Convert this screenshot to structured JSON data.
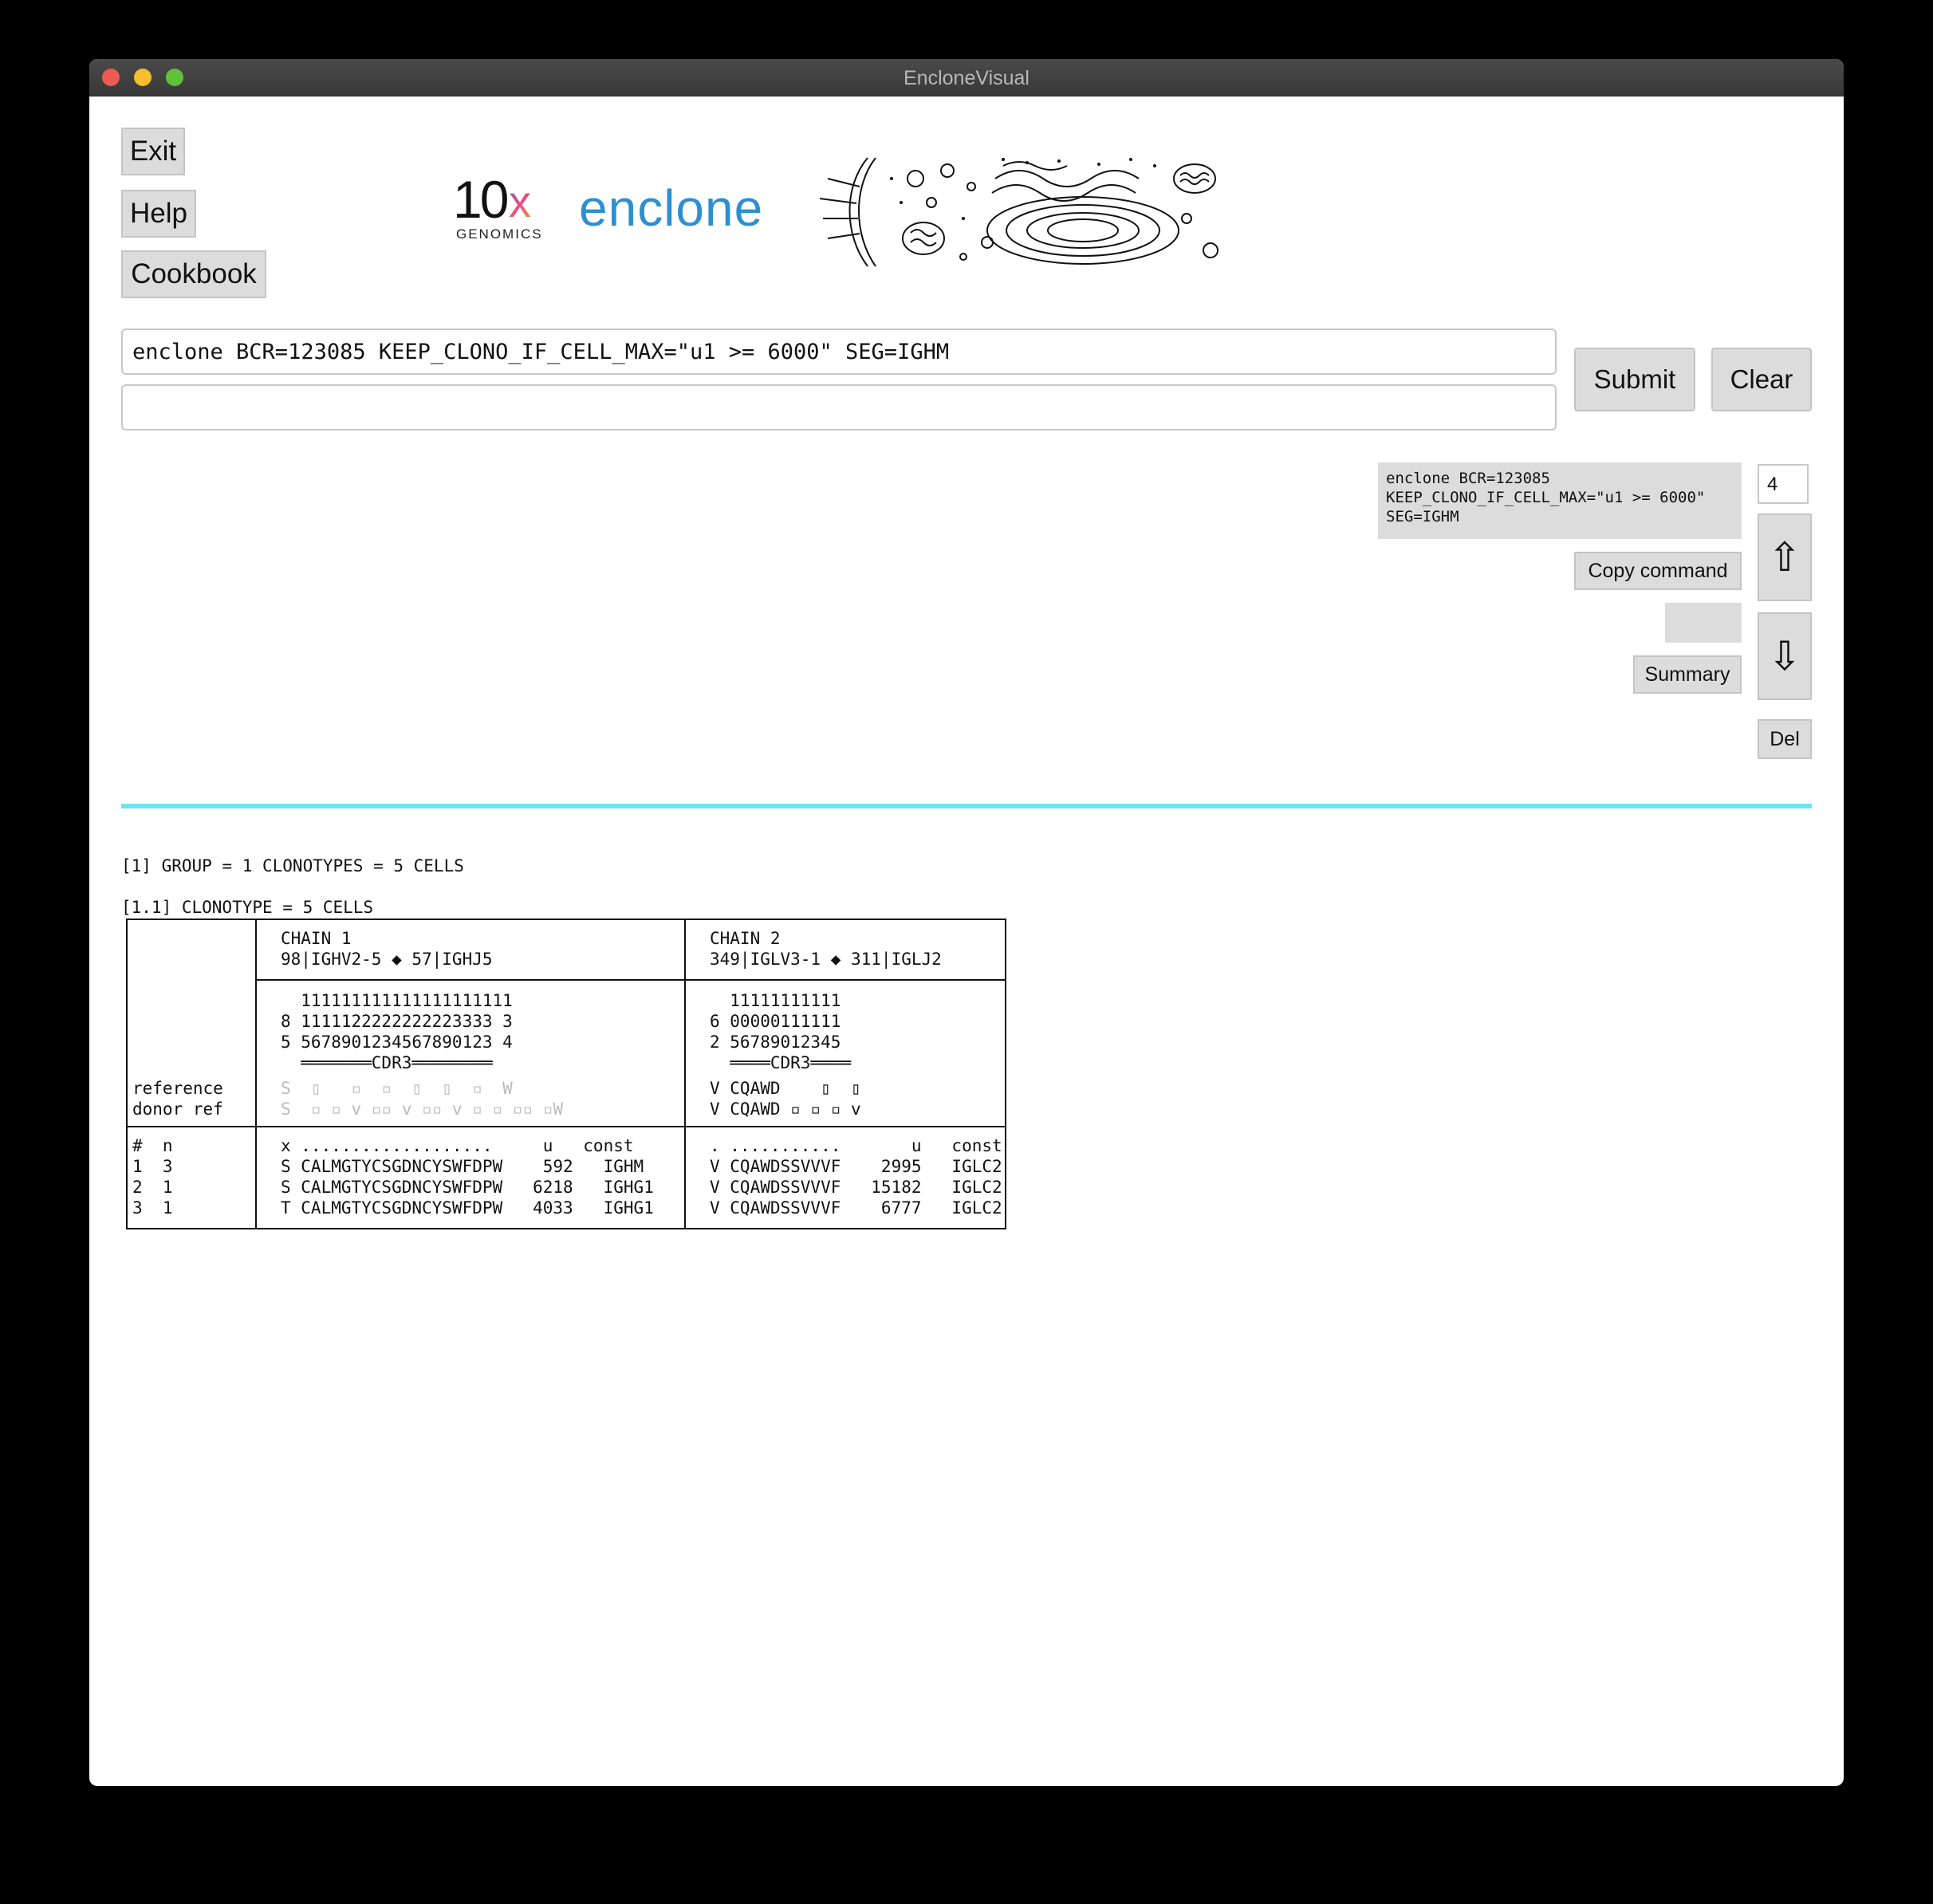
{
  "window": {
    "title": "EncloneVisual"
  },
  "left_buttons": {
    "exit": "Exit",
    "help": "Help",
    "cookbook": "Cookbook"
  },
  "logo": {
    "brand_number": "10",
    "brand_x": "x",
    "brand_sub": "GENOMICS",
    "product": "enclone"
  },
  "command": {
    "input_value": "enclone BCR=123085 KEEP_CLONO_IF_CELL_MAX=\"u1 >= 6000\" SEG=IGHM",
    "second_input_value": "",
    "submit": "Submit",
    "clear": "Clear"
  },
  "history": {
    "command_line1": "enclone BCR=123085",
    "command_line2": "KEEP_CLONO_IF_CELL_MAX=\"u1 >= 6000\"",
    "command_line3": "SEG=IGHM",
    "index": "4",
    "copy_command": "Copy command",
    "name_box": "",
    "summary": "Summary",
    "up_icon": "arrow-up-icon",
    "down_icon": "arrow-down-icon",
    "up_glyph": "⇧",
    "down_glyph": "⇩",
    "del": "Del"
  },
  "output": {
    "group_header": "[1] GROUP = 1 CLONOTYPES = 5 CELLS",
    "clonotype_header": "[1.1] CLONOTYPE = 5 CELLS",
    "table": {
      "left_labels_1": "reference",
      "left_labels_2": "donor ref",
      "rows_head": "#  n",
      "row1_left": "1  3",
      "row2_left": "2  1",
      "row3_left": "3  1",
      "chain1": {
        "title": "CHAIN 1",
        "subtitle": "98|IGHV2-5 ◆ 57|IGHJ5",
        "pos_line1": "  111111111111111111111",
        "pos_line2": "8 1111122222222223333 3",
        "pos_line3": "5 5678901234567890123 4",
        "cdr3_line": "  ═══════CDR3════════",
        "ref_line": "S  ▯   ▫  ▫  ▯  ▯  ▫  W",
        "donor_line": "S  ▫ ▫ v ▫▫ v ▫▫ v ▫ ▫ ▫▫ ▫W",
        "head_line": "x ...................     u   const",
        "row1": "S CALMGTYCSGDNCYSWFDPW    592   IGHM",
        "row2": "S CALMGTYCSGDNCYSWFDPW   6218   IGHG1",
        "row3": "T CALMGTYCSGDNCYSWFDPW   4033   IGHG1"
      },
      "chain2": {
        "title": "CHAIN 2",
        "subtitle": "349|IGLV3-1 ◆ 311|IGLJ2",
        "pos_line1": "  11111111111",
        "pos_line2": "6 00000111111",
        "pos_line3": "2 56789012345",
        "cdr3_line": "  ════CDR3════",
        "ref_line": "V CQAWD    ▯  ▯",
        "donor_line": "V CQAWD ▫ ▫ ▫ v",
        "head_line": ". ...........       u   const",
        "row1": "V CQAWDSSVVVF    2995   IGLC2",
        "row2": "V CQAWDSSVVVF   15182   IGLC2",
        "row3": "V CQAWDSSVVVF    6777   IGLC2"
      }
    }
  },
  "colors": {
    "divider": "#6fe3f2",
    "brand_blue": "#2d8fd0",
    "close": "#ee5a52",
    "minimize": "#f5bd2f",
    "zoom": "#5fc23a"
  }
}
